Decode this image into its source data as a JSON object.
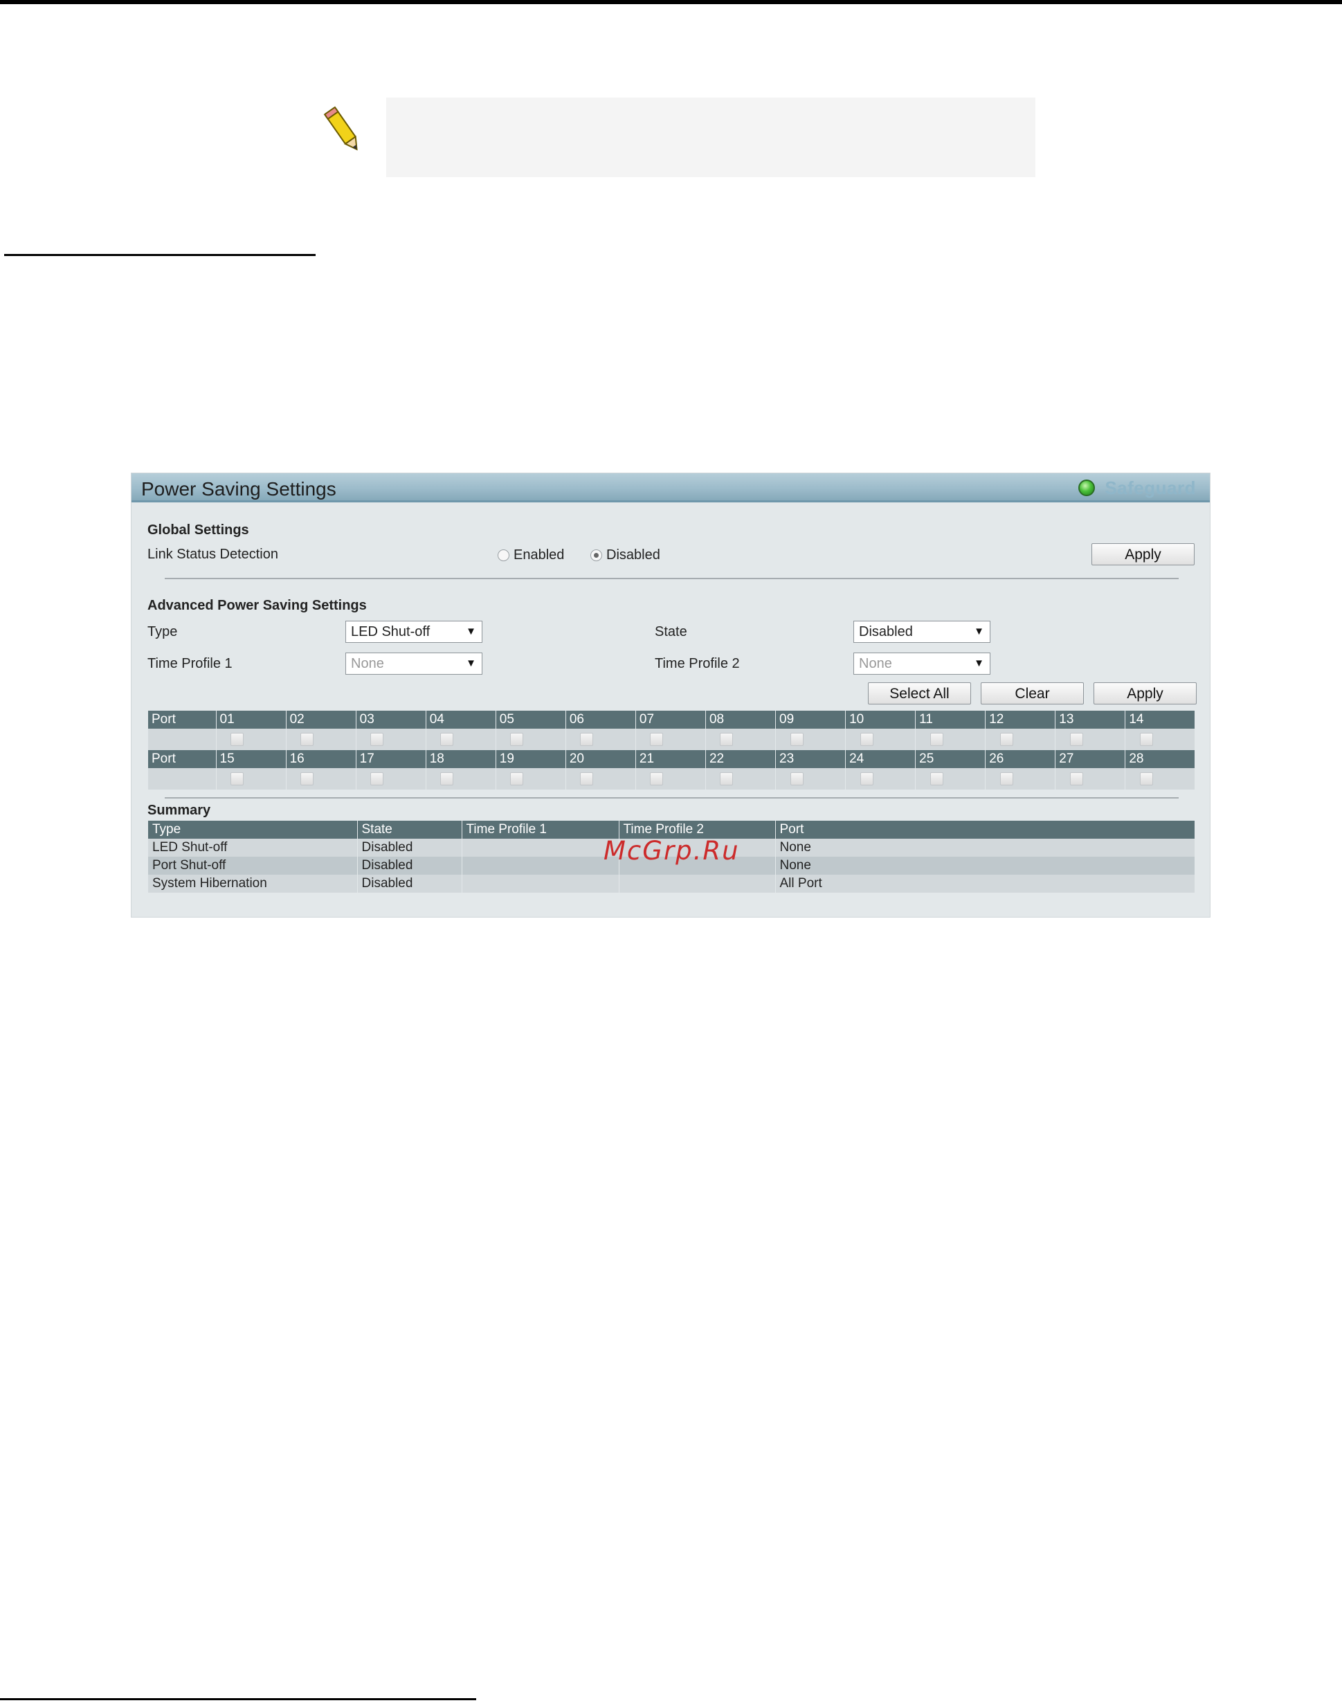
{
  "panel": {
    "title": "Power Saving Settings",
    "badge": "Safeguard"
  },
  "global": {
    "heading": "Global Settings",
    "link_status_label": "Link Status Detection",
    "enabled_label": "Enabled",
    "disabled_label": "Disabled",
    "selected": "Disabled",
    "apply_label": "Apply"
  },
  "advanced": {
    "heading": "Advanced Power Saving Settings",
    "type_label": "Type",
    "type_value": "LED Shut-off",
    "state_label": "State",
    "state_value": "Disabled",
    "time_profile1_label": "Time Profile 1",
    "time_profile1_value": "None",
    "time_profile2_label": "Time Profile 2",
    "time_profile2_value": "None",
    "select_all_label": "Select All",
    "clear_label": "Clear",
    "apply_label": "Apply"
  },
  "ports": {
    "row_label": "Port",
    "row1": [
      "01",
      "02",
      "03",
      "04",
      "05",
      "06",
      "07",
      "08",
      "09",
      "10",
      "11",
      "12",
      "13",
      "14"
    ],
    "row2": [
      "15",
      "16",
      "17",
      "18",
      "19",
      "20",
      "21",
      "22",
      "23",
      "24",
      "25",
      "26",
      "27",
      "28"
    ]
  },
  "summary": {
    "heading": "Summary",
    "columns": [
      "Type",
      "State",
      "Time Profile 1",
      "Time Profile 2",
      "Port"
    ],
    "rows": [
      [
        "LED Shut-off",
        "Disabled",
        "",
        "",
        "None"
      ],
      [
        "Port Shut-off",
        "Disabled",
        "",
        "",
        "None"
      ],
      [
        "System Hibernation",
        "Disabled",
        "",
        "",
        "All Port"
      ]
    ]
  },
  "watermark": "McGrp.Ru",
  "colors": {
    "header_row": "#597075",
    "panel_bg": "#e3e8ea",
    "title_bar": "#9dbccb",
    "watermark": "#cc2b2b"
  }
}
